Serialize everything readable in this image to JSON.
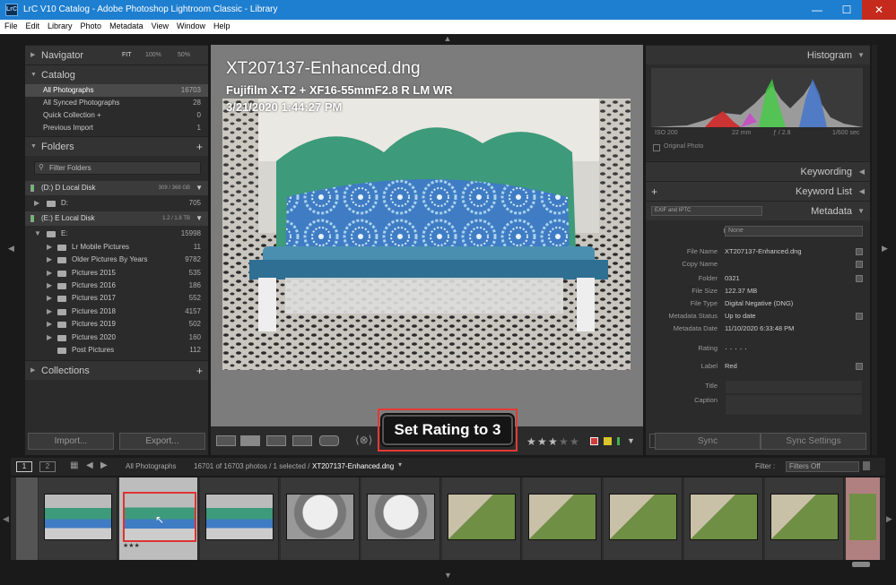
{
  "titlebar": {
    "icon_text": "LrC",
    "title": "LrC V10 Catalog - Adobe Photoshop Lightroom Classic - Library",
    "minimize": "—",
    "maximize": "☐",
    "close": "✕"
  },
  "menu": [
    "File",
    "Edit",
    "Library",
    "Photo",
    "Metadata",
    "View",
    "Window",
    "Help"
  ],
  "navigator": {
    "title": "Navigator",
    "zoom": [
      "FIT",
      "100%",
      "50%"
    ]
  },
  "catalog": {
    "title": "Catalog",
    "items": [
      {
        "label": "All Photographs",
        "count": "16703"
      },
      {
        "label": "All Synced Photographs",
        "count": "28"
      },
      {
        "label": "Quick Collection +",
        "count": "0"
      },
      {
        "label": "Previous Import",
        "count": "1"
      }
    ]
  },
  "folders": {
    "title": "Folders",
    "add": "+",
    "filter_placeholder": "Filter Folders",
    "disk_d": {
      "label": "(D:) D Local Disk",
      "capacity": "309 / 368 GB"
    },
    "d_root": {
      "label": "D:",
      "count": "705"
    },
    "disk_e": {
      "label": "(E:) E Local Disk",
      "capacity": "1.2 / 1.8 TB"
    },
    "e_root": {
      "label": "E:",
      "count": "15998"
    },
    "items": [
      {
        "label": "Lr Mobile Pictures",
        "count": "11"
      },
      {
        "label": "Older Pictures By Years",
        "count": "9782"
      },
      {
        "label": "Pictures 2015",
        "count": "535"
      },
      {
        "label": "Pictures 2016",
        "count": "186"
      },
      {
        "label": "Pictures 2017",
        "count": "552"
      },
      {
        "label": "Pictures 2018",
        "count": "4157"
      },
      {
        "label": "Pictures 2019",
        "count": "502"
      },
      {
        "label": "Pictures 2020",
        "count": "160"
      },
      {
        "label": "Post Pictures",
        "count": "112"
      }
    ]
  },
  "collections": {
    "title": "Collections",
    "add": "+"
  },
  "left_buttons": {
    "import": "Import...",
    "export": "Export..."
  },
  "photo_overlay": {
    "filename": "XT207137-Enhanced.dng",
    "camera": "Fujifilm X-T2 + XF16-55mmF2.8 R LM WR",
    "date": "3/21/2020 1:44:27 PM"
  },
  "toolbar": {
    "rating_tooltip": "Set Rating to 3",
    "stars_filled": 3,
    "stars_total": 5,
    "colors": {
      "red": "#d13b3b",
      "yellow": "#d9c62a",
      "green": "#3fb34f"
    }
  },
  "histogram": {
    "title": "Histogram",
    "iso": "ISO 200",
    "focal": "22 mm",
    "aperture": "ƒ / 2.8",
    "shutter": "1/600 sec",
    "original_photo": "Original Photo"
  },
  "right_sections": {
    "keywording": "Keywording",
    "keyword_list": "Keyword List",
    "metadata": "Metadata",
    "metadata_set": "EXIF and IPTC",
    "preset_label": "Preset",
    "preset_value": "None"
  },
  "metadata": {
    "file_name": {
      "label": "File Name",
      "value": "XT207137-Enhanced.dng"
    },
    "copy_name": {
      "label": "Copy Name",
      "value": ""
    },
    "folder": {
      "label": "Folder",
      "value": "0321"
    },
    "file_size": {
      "label": "File Size",
      "value": "122.37 MB"
    },
    "file_type": {
      "label": "File Type",
      "value": "Digital Negative (DNG)"
    },
    "metadata_status": {
      "label": "Metadata Status",
      "value": "Up to date"
    },
    "metadata_date": {
      "label": "Metadata Date",
      "value": "11/10/2020 6:33:48 PM"
    },
    "rating": {
      "label": "Rating",
      "value": "· · · · ·"
    },
    "label": {
      "label": "Label",
      "value": "Red"
    },
    "title": {
      "label": "Title",
      "value": ""
    },
    "caption": {
      "label": "Caption",
      "value": ""
    }
  },
  "right_buttons": {
    "sync": "Sync",
    "sync_settings": "Sync Settings"
  },
  "filmstrip": {
    "page1": "1",
    "page2": "2",
    "source": "All Photographs",
    "status": "16701 of 16703 photos / 1 selected /",
    "current_file": "XT207137-Enhanced.dng",
    "filter_label": "Filter :",
    "filter_value": "Filters Off",
    "selected_stars": "★★★"
  }
}
